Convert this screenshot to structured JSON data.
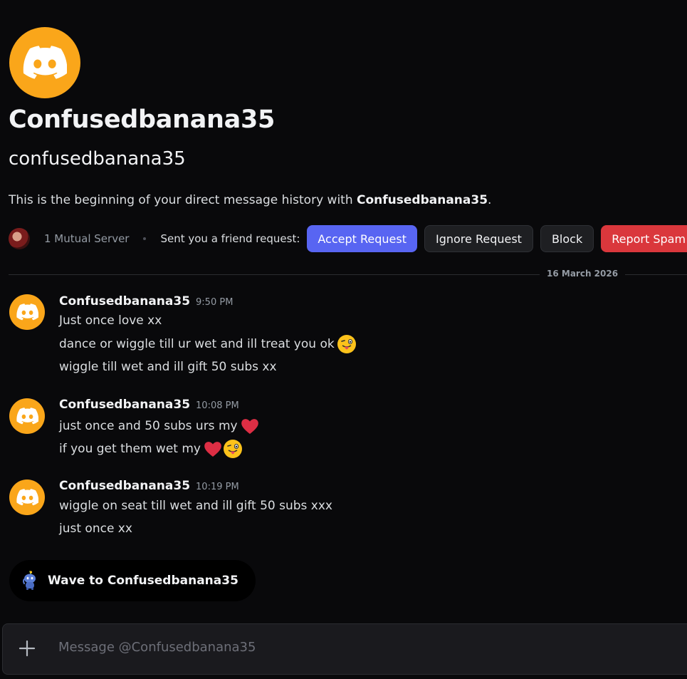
{
  "profile": {
    "display_name": "Confusedbanana35",
    "username": "confusedbanana35",
    "intro_prefix": "This is the beginning of your direct message history with ",
    "intro_name": "Confusedbanana35",
    "intro_suffix": ".",
    "avatar_color": "#faa61a",
    "avatar_icon": "discord-logo-icon"
  },
  "friend_bar": {
    "mutual": "1 Mutual Server",
    "request_text": "Sent you a friend request:",
    "accept": "Accept Request",
    "ignore": "Ignore Request",
    "block": "Block",
    "report": "Report Spam"
  },
  "date_divider": "16 March 2026",
  "messages": [
    {
      "author": "Confusedbanana35",
      "time": "9:50 PM",
      "lines": [
        "Just once love xx",
        "dance or wiggle till ur wet and ill treat you ok",
        "wiggle till wet and ill gift 50 subs xx"
      ]
    },
    {
      "author": "Confusedbanana35",
      "time": "10:08 PM",
      "lines": [
        "just once and 50 subs urs my",
        "if you get them wet my"
      ]
    },
    {
      "author": "Confusedbanana35",
      "time": "10:19 PM",
      "lines": [
        "wiggle on seat till wet and ill gift 50 subs xxx",
        "just once xx"
      ]
    }
  ],
  "wave": {
    "label": "Wave to Confusedbanana35",
    "icon": "wumpus-wave-icon"
  },
  "composer": {
    "placeholder": "Message @Confusedbanana35",
    "add_icon": "plus-icon"
  },
  "colors": {
    "accent": "#5865f2",
    "danger": "#da373c",
    "avatar": "#faa61a"
  }
}
